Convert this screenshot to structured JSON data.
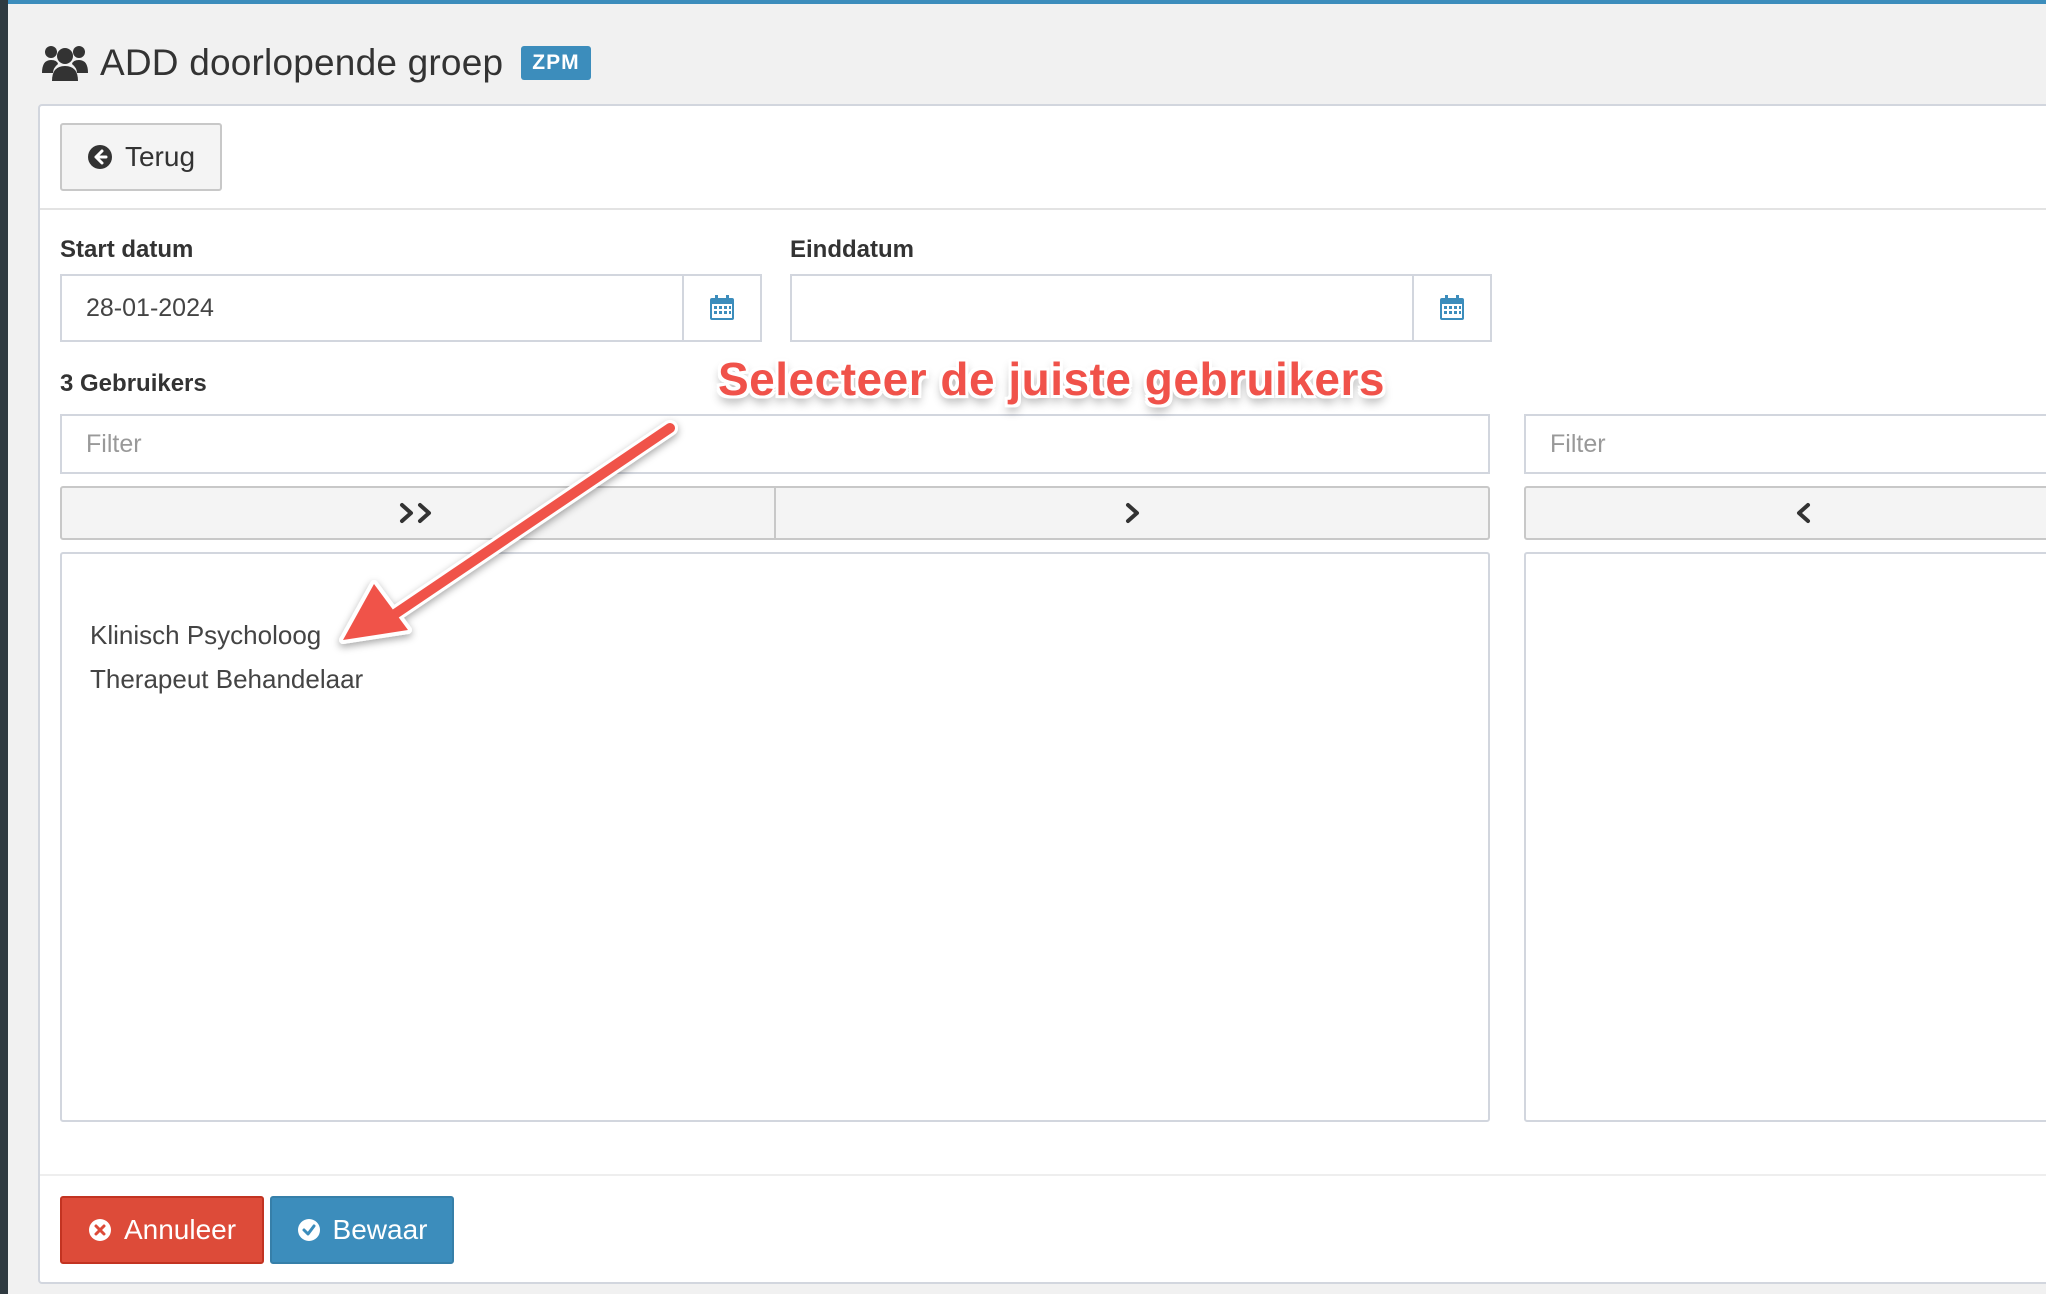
{
  "header": {
    "title": "ADD doorlopende groep",
    "badge": "ZPM"
  },
  "toolbar": {
    "back_label": "Terug"
  },
  "form": {
    "start_label": "Start datum",
    "start_value": "28-01-2024",
    "end_label": "Einddatum",
    "end_value": "",
    "users_label": "3 Gebruikers"
  },
  "dual_list": {
    "left_filter_placeholder": "Filter",
    "right_filter_placeholder": "Filter",
    "available": [
      "Klinisch Psycholoog",
      "Therapeut Behandelaar"
    ],
    "selected": []
  },
  "footer": {
    "cancel_label": "Annuleer",
    "save_label": "Bewaar"
  },
  "annotation": {
    "text": "Selecteer de juiste gebruikers"
  },
  "colors": {
    "primary": "#3c8dbc",
    "danger": "#dd4b39",
    "annotation": "#f0524a"
  }
}
